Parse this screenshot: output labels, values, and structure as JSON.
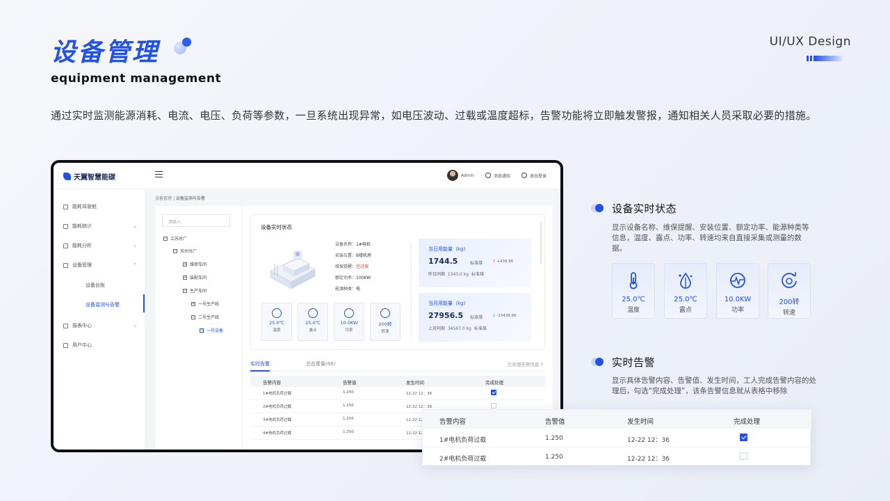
{
  "hero": {
    "title": "设备管理",
    "subtitle": "equipment management",
    "tag": "UI/UX Design",
    "description": "通过实时监测能源消耗、电流、电压、负荷等参数，一旦系统出现异常，如电压波动、过载或温度超标，告警功能将立即触发警报，通知相关人员采取必要的措施。"
  },
  "colors": {
    "accent": "#2351e6",
    "danger": "#e33333",
    "success": "#1aa56c"
  },
  "app": {
    "logo": "天翼智慧能碳",
    "topbar": {
      "user": "Admin",
      "notice": "消息通知",
      "logout": "退出登录"
    },
    "sidebar": {
      "items": [
        {
          "label": "能耗驾驶舱",
          "icon": "home-icon"
        },
        {
          "label": "能耗统计",
          "icon": "stats-icon"
        },
        {
          "label": "能耗分析",
          "icon": "analysis-icon"
        },
        {
          "label": "设备管理",
          "icon": "device-icon"
        },
        {
          "label": "报表中心",
          "icon": "report-icon"
        },
        {
          "label": "用户中心",
          "icon": "user-icon"
        }
      ],
      "sub": [
        "设备台账",
        "设备监测与告警"
      ]
    },
    "breadcrumb": {
      "parent": "设备管理",
      "sep": "|",
      "current": "设备监测与告警"
    },
    "tree": {
      "placeholder": "请输入",
      "nodes": [
        "江苏总厂",
        "苏州分厂",
        "维修车间",
        "装配车间",
        "生产车间",
        "一号生产线",
        "二号生产线",
        "一号设备"
      ]
    },
    "status": {
      "title": "设备实时状态",
      "info": [
        {
          "k": "设备名称：",
          "v": "1#电机"
        },
        {
          "k": "安装位置：",
          "v": "B楼机房"
        },
        {
          "k": "维保提醒：",
          "v": "已过保"
        },
        {
          "k": "额定功率：",
          "v": "100KW"
        },
        {
          "k": "能源种类：",
          "v": "电"
        }
      ],
      "minis": [
        {
          "value": "25.0℃",
          "label": "温度",
          "icon": "thermometer-icon"
        },
        {
          "value": "25.0℃",
          "label": "露点",
          "icon": "dewpoint-icon"
        },
        {
          "value": "10.0KW",
          "label": "功率",
          "icon": "power-icon"
        },
        {
          "value": "200转",
          "label": "转速",
          "icon": "rotation-icon"
        }
      ],
      "daily": {
        "title": "当日用能量（kg)",
        "value": "1744.5",
        "unit": "标准煤",
        "delta": "+438.86",
        "prev_label": "昨日同期",
        "prev_value": "1343.0 kg",
        "prev_unit": "标准煤"
      },
      "monthly": {
        "title": "当月用能量（kg)",
        "value": "27956.5",
        "unit": "标准煤",
        "delta": "-13438.86",
        "prev_label": "上月同期",
        "prev_value": "34567.0 kg",
        "prev_unit": "标准煤"
      }
    },
    "tabs": {
      "active": "实时告警",
      "other": "总告警量(68)",
      "right": "已处理告警信息 》"
    },
    "table": {
      "headers": [
        "告警内容",
        "告警值",
        "发生时间",
        "完成处理"
      ],
      "rows": [
        {
          "content": "1#电机负荷过载",
          "value": "1.250",
          "time": "12-22  12：36",
          "done": true
        },
        {
          "content": "2#电机负荷过载",
          "value": "1.250",
          "time": "12-22  12：36",
          "done": false
        },
        {
          "content": "3#电机负荷过载",
          "value": "1.250",
          "time": "12-22  12：36",
          "done": false
        },
        {
          "content": "4#电机负荷过载",
          "value": "1.250",
          "time": "12-22  12：36",
          "done": false
        }
      ]
    }
  },
  "features": {
    "status": {
      "title": "设备实时状态",
      "desc": "显示设备名称、维保提醒、安装位置、额定功率、能源种类等信息，温度、露点、功率、转速均来自直接采集或测量的数据。",
      "cards": [
        {
          "value": "25.0℃",
          "label": "温度",
          "icon": "thermometer-icon"
        },
        {
          "value": "25.0℃",
          "label": "露点",
          "icon": "dewpoint-icon"
        },
        {
          "value": "10.0KW",
          "label": "功率",
          "icon": "power-icon"
        },
        {
          "value": "200转",
          "label": "转速",
          "icon": "rotation-icon"
        }
      ]
    },
    "alarm": {
      "title": "实时告警",
      "desc": "显示具体告警内容、告警值、发生时间，工人完成告警内容的处理后，勾选“完成处理”，该条告警信息就从表格中移除",
      "headers": [
        "告警内容",
        "告警值",
        "发生时间",
        "完成处理"
      ],
      "rows": [
        {
          "content": "1#电机负荷过载",
          "value": "1.250",
          "time": "12-22  12：36",
          "done": true
        },
        {
          "content": "2#电机负荷过载",
          "value": "1.250",
          "time": "12-22  12：36",
          "done": false
        }
      ]
    }
  }
}
